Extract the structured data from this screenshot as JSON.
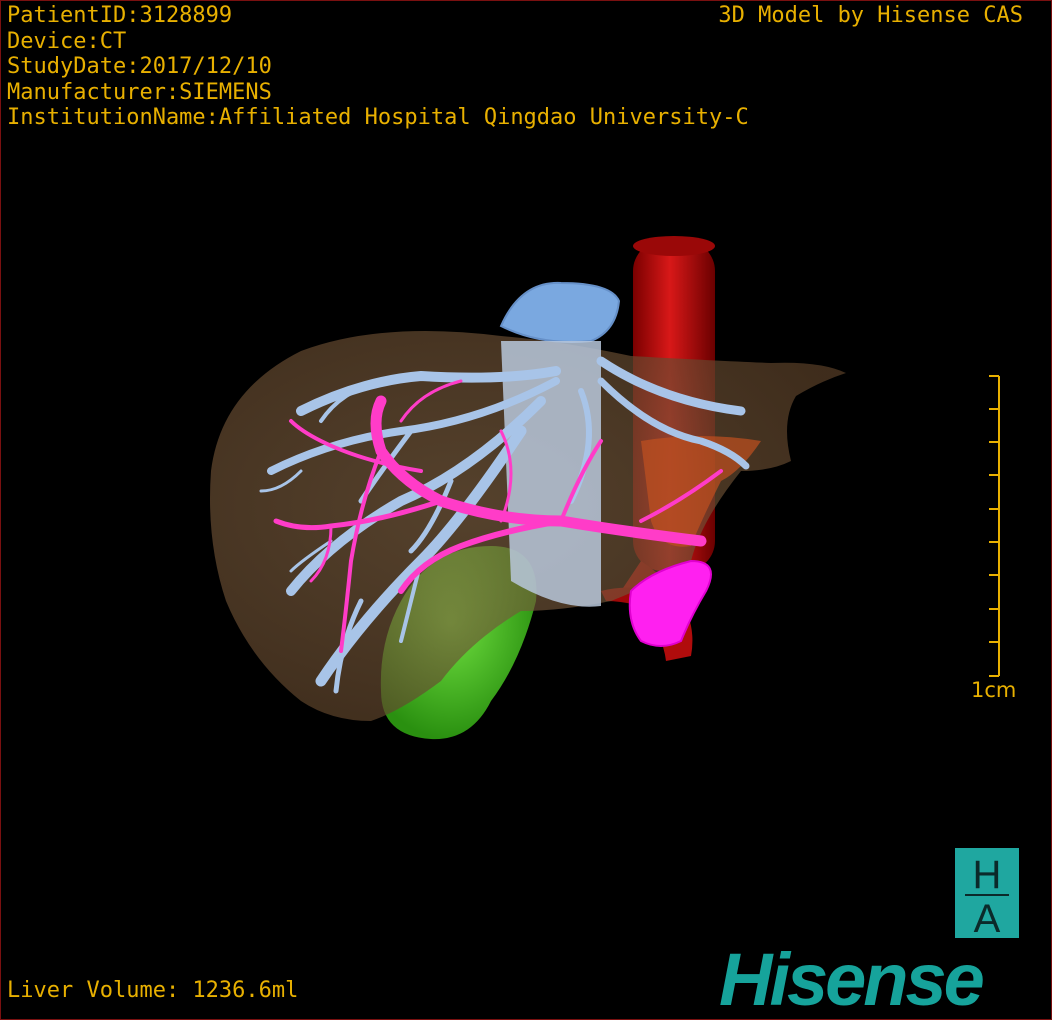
{
  "overlay": {
    "patient_id": "PatientID:3128899",
    "device": "Device:CT",
    "study_date": "StudyDate:2017/12/10",
    "manufacturer": "Manufacturer:SIEMENS",
    "institution": "InstitutionName:Affiliated Hospital Qingdao University-C",
    "brand_caption": "3D Model by Hisense CAS",
    "liver_volume": "Liver Volume: 1236.6ml"
  },
  "scale_bar": {
    "label": "1cm",
    "ticks": 10
  },
  "logo": {
    "badge_top": "H",
    "badge_bottom": "A",
    "wordmark": "Hisense"
  },
  "colors": {
    "overlay_text": "#e8b000",
    "liver": "#a07850",
    "hepatic_vein": "#9fbfe0",
    "portal_vein": "#ff3cc8",
    "aorta": "#c81010",
    "gallbladder": "#40c020",
    "brand": "#16a39b"
  },
  "structures": {
    "liver_icon": "liver-icon",
    "vessel_icon": "vessel-icon"
  }
}
